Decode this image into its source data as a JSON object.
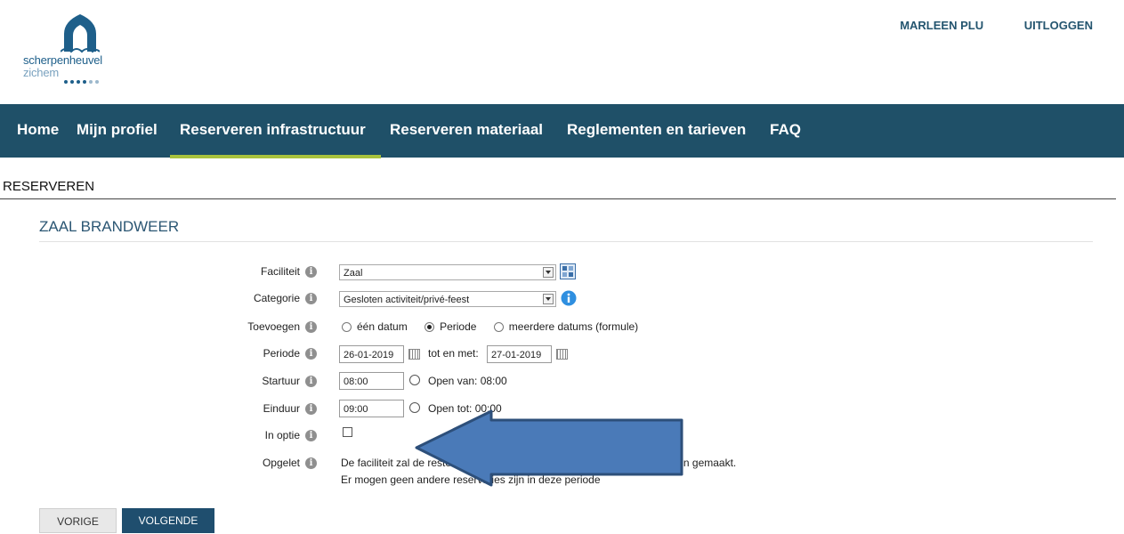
{
  "header": {
    "logo_line1": "scherpenheuvel",
    "logo_line2": "zichem",
    "user_name": "MARLEEN PLU",
    "logout": "UITLOGGEN"
  },
  "nav": {
    "items": [
      "Home",
      "Mijn profiel",
      "Reserveren infrastructuur",
      "Reserveren materiaal",
      "Reglementen en tarieven",
      "FAQ"
    ],
    "active_index": 2
  },
  "page": {
    "title": "RESERVEREN",
    "subtitle": "ZAAL BRANDWEER"
  },
  "form": {
    "faciliteit": {
      "label": "Faciliteit",
      "value": "Zaal"
    },
    "categorie": {
      "label": "Categorie",
      "value": "Gesloten activiteit/privé-feest"
    },
    "toevoegen": {
      "label": "Toevoegen",
      "options": [
        "één datum",
        "Periode",
        "meerdere datums (formule)"
      ],
      "selected": "Periode"
    },
    "periode": {
      "label": "Periode",
      "start": "26-01-2019",
      "mid_label": "tot en met:",
      "end": "27-01-2019"
    },
    "startuur": {
      "label": "Startuur",
      "value": "08:00",
      "note": "Open van: 08:00"
    },
    "einduur": {
      "label": "Einduur",
      "value": "09:00",
      "note": "Open tot: 00:00"
    },
    "in_optie": {
      "label": "In optie",
      "checked": false
    },
    "opgelet": {
      "label": "Opgelet",
      "line1": "De faciliteit zal de resterende dag na de reservatie onbeschikbaar worden gemaakt.",
      "line2": "Er mogen geen andere reservaties zijn in deze periode"
    }
  },
  "buttons": {
    "prev": "VORIGE",
    "next": "VOLGENDE"
  },
  "colors": {
    "nav_bg": "#1f5068",
    "nav_active": "#a8c23d",
    "primary_button": "#1f4e6e",
    "annotation_arrow": "#4a7ab8"
  }
}
